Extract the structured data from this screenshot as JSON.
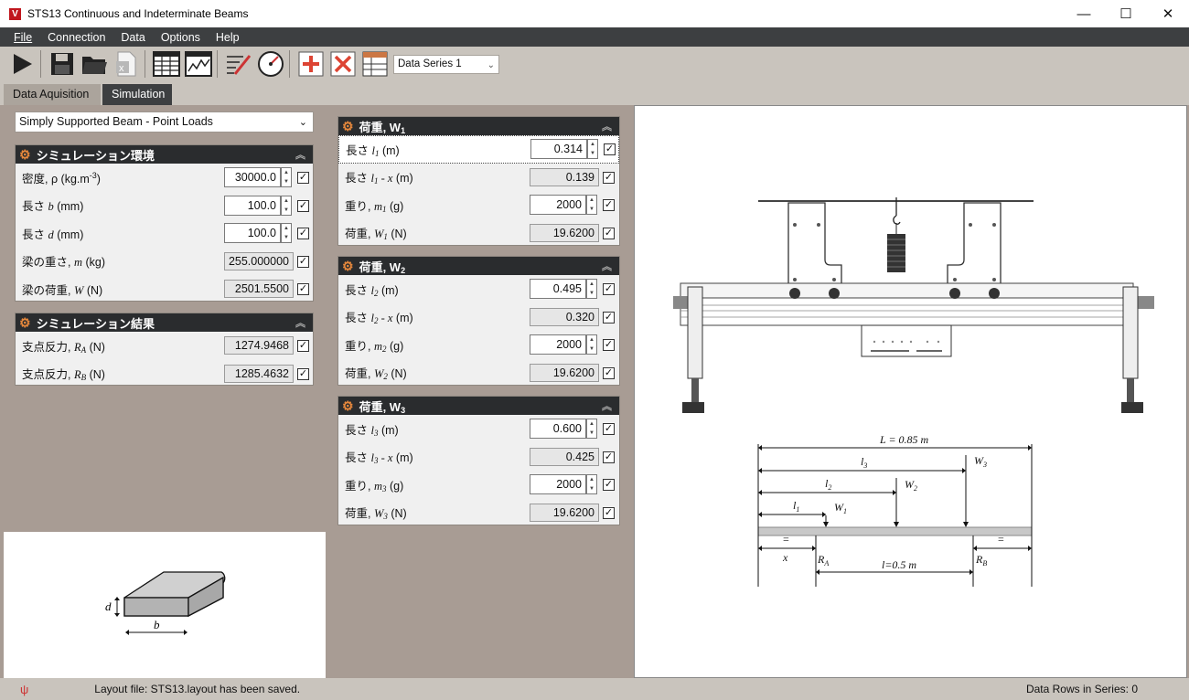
{
  "window": {
    "title": "STS13 Continuous and Indeterminate Beams",
    "icon_letter": "V"
  },
  "menu": {
    "items": [
      "File",
      "Connection",
      "Data",
      "Options",
      "Help"
    ]
  },
  "toolbar": {
    "series_select": "Data Series 1"
  },
  "tabs": [
    {
      "label": "Data Aquisition"
    },
    {
      "label": "Simulation"
    }
  ],
  "beam_select": "Simply Supported Beam - Point Loads",
  "env_panel": {
    "title": "シミュレーション環境",
    "rows": [
      {
        "label": "密度, ρ (kg.m",
        "sup": "-3",
        "suffix": ")",
        "value": "30000.0"
      },
      {
        "label": "長さ ",
        "var": "b",
        "unit": " (mm)",
        "value": "100.0"
      },
      {
        "label": "長さ ",
        "var": "d",
        "unit": " (mm)",
        "value": "100.0"
      },
      {
        "label": "梁の重さ, ",
        "var": "m",
        "unit": " (kg)",
        "value": "255.000000"
      },
      {
        "label": "梁の荷重, ",
        "var": "W",
        "unit": " (N)",
        "value": "2501.5500"
      }
    ]
  },
  "result_panel": {
    "title": "シミュレーション結果",
    "rows": [
      {
        "label": "支点反力, ",
        "var": "R",
        "sub": "A",
        "unit": " (N)",
        "value": "1274.9468"
      },
      {
        "label": "支点反力, ",
        "var": "R",
        "sub": "B",
        "unit": " (N)",
        "value": "1285.4632"
      }
    ]
  },
  "loads": [
    {
      "title": "荷重, W",
      "sub": "1",
      "l": "0.314",
      "lx": "0.139",
      "m": "2000",
      "W": "19.6200"
    },
    {
      "title": "荷重, W",
      "sub": "2",
      "l": "0.495",
      "lx": "0.320",
      "m": "2000",
      "W": "19.6200"
    },
    {
      "title": "荷重, W",
      "sub": "3",
      "l": "0.600",
      "lx": "0.425",
      "m": "2000",
      "W": "19.6200"
    }
  ],
  "load_labels": {
    "length": "長さ ",
    "length_x": "長さ ",
    "mass": "重り, ",
    "load": "荷重, ",
    "unit_m": " (m)",
    "unit_g": " (g)",
    "unit_N": " (N)",
    "minus_x": " - x"
  },
  "diagram": {
    "L_label": "L = 0.85 m",
    "l_label": "l=0.5 m",
    "x_label": "x",
    "RA": "R",
    "RA_sub": "A",
    "RB": "R",
    "RB_sub": "B",
    "eq": "="
  },
  "section": {
    "d": "d",
    "b": "b"
  },
  "status": {
    "message": "Layout file: STS13.layout has been saved.",
    "rows": "Data Rows in Series: 0"
  }
}
